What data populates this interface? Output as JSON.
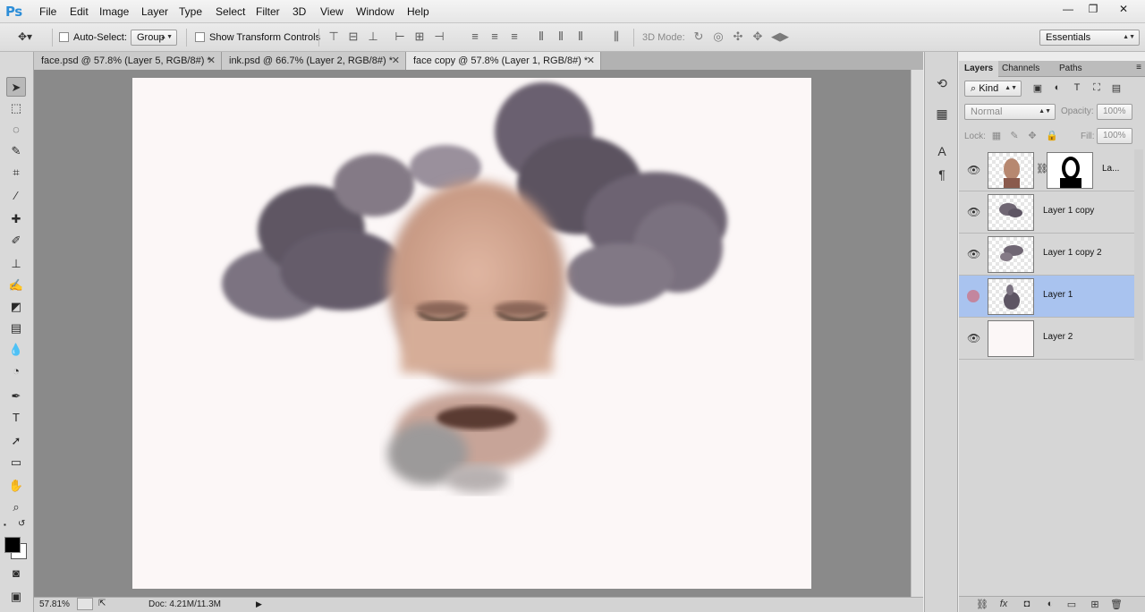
{
  "app": {
    "logo": "Ps"
  },
  "menu": [
    "File",
    "Edit",
    "Image",
    "Layer",
    "Type",
    "Select",
    "Filter",
    "3D",
    "View",
    "Window",
    "Help"
  ],
  "window_controls": {
    "minimize": "—",
    "restore": "❐",
    "close": "✕"
  },
  "options": {
    "auto_select_label": "Auto-Select:",
    "auto_select_mode": "Group",
    "show_transform_label": "Show Transform Controls",
    "mode_3d_label": "3D Mode:",
    "workspace": "Essentials"
  },
  "tabs": [
    {
      "label": "face.psd @ 57.8% (Layer 5, RGB/8#) *"
    },
    {
      "label": "ink.psd @ 66.7% (Layer 2, RGB/8#) *"
    },
    {
      "label": "face copy @ 57.8% (Layer 1, RGB/8#) *"
    }
  ],
  "tab_close": "✕",
  "status": {
    "zoom": "57.81%",
    "doc": "Doc: 4.21M/11.3M"
  },
  "layers_panel": {
    "tabs": [
      "Layers",
      "Channels",
      "Paths"
    ],
    "filter": "Kind",
    "blend_mode": "Normal",
    "opacity_label": "Opacity:",
    "opacity_value": "100%",
    "lock_label": "Lock:",
    "fill_label": "Fill:",
    "fill_value": "100%",
    "layers": [
      {
        "name": "La...",
        "selected": false
      },
      {
        "name": "Layer 1 copy",
        "selected": false
      },
      {
        "name": "Layer 1 copy 2",
        "selected": false
      },
      {
        "name": "Layer 1",
        "selected": true
      },
      {
        "name": "Layer 2",
        "selected": false
      }
    ]
  },
  "colors": {
    "accent": "#2d8ed8",
    "selection": "#a9c3ef",
    "canvas_bg": "#8a8a8a"
  }
}
